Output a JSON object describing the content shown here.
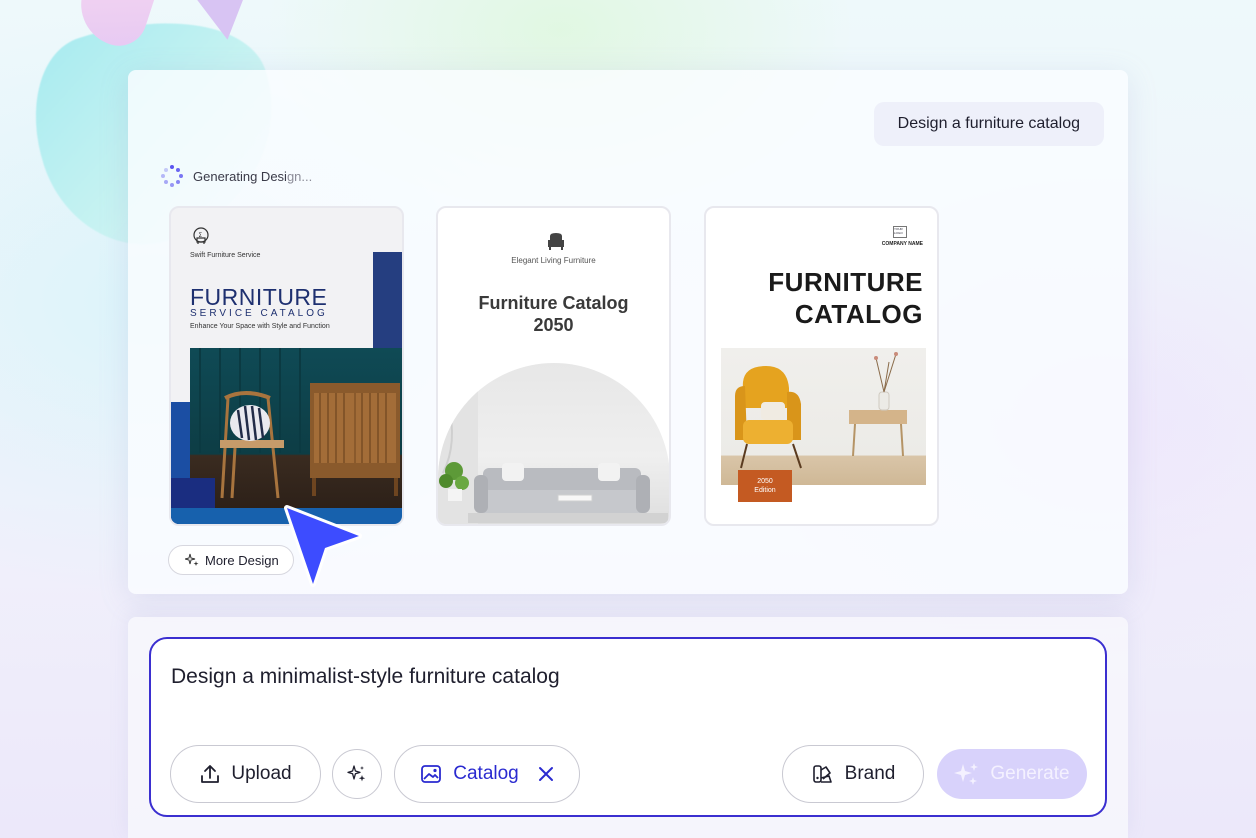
{
  "conversation": {
    "user_prompt": "Design a furniture catalog",
    "status_text_main": "Generating Desi",
    "status_text_fade": "gn..."
  },
  "designs": [
    {
      "brand": "Swift Furniture Service",
      "title": "FURNITURE",
      "subtitle": "SERVICE CATALOG",
      "tagline": "Enhance Your Space with Style and Function"
    },
    {
      "brand": "Elegant Living Furniture",
      "title_line1": "Furniture Catalog",
      "title_line2": "2050"
    },
    {
      "logo_text": "YOUR LOGO",
      "company": "COMPANY NAME",
      "title_line1": "FURNITURE",
      "title_line2": "CATALOG",
      "badge_line1": "2050",
      "badge_line2": "Edition"
    }
  ],
  "more_design_label": "More Design",
  "composer": {
    "input_value": "Design a minimalist-style furniture catalog",
    "upload_label": "Upload",
    "catalog_label": "Catalog",
    "brand_label": "Brand",
    "generate_label": "Generate"
  },
  "colors": {
    "accent": "#3b2fd0",
    "generate_disabled": "#d8d2fb",
    "cursor": "#3d4cff"
  }
}
